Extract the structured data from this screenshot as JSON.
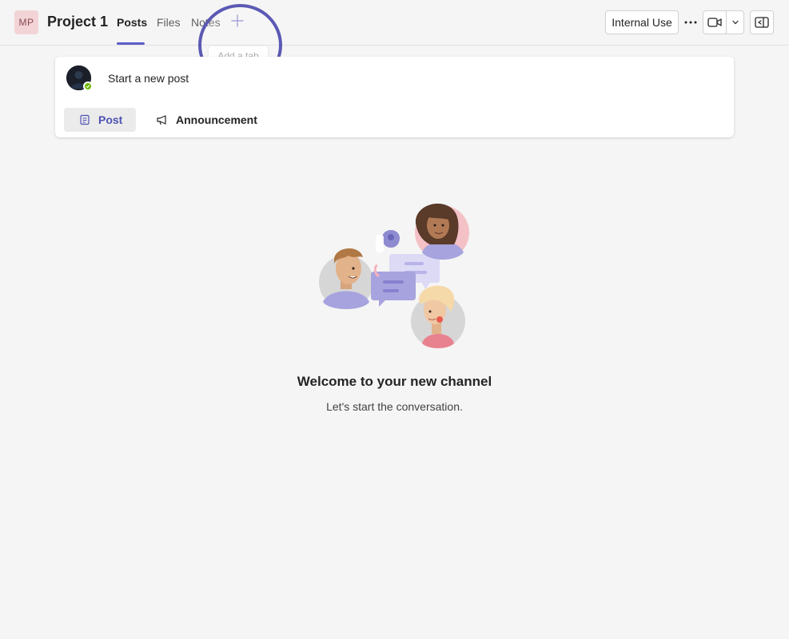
{
  "header": {
    "team_initials": "MP",
    "team_name": "Project 1",
    "tabs": [
      {
        "label": "Posts",
        "active": true
      },
      {
        "label": "Files",
        "active": false
      },
      {
        "label": "Notes",
        "active": false
      }
    ],
    "add_tab_tooltip": "Add a tab",
    "sensitivity_label": "Internal Use",
    "icons": {
      "add_tab": "plus-icon",
      "more": "more-horizontal-icon",
      "video": "video-camera-icon",
      "dropdown": "chevron-down-icon",
      "panel": "panel-toggle-icon"
    }
  },
  "compose": {
    "prompt": "Start a new post",
    "post_label": "Post",
    "announcement_label": "Announcement",
    "presence_status": "available"
  },
  "empty_state": {
    "title": "Welcome to your new channel",
    "subtitle": "Let's start the conversation."
  },
  "colors": {
    "accent": "#5b5fc7",
    "highlight_ring": "#5b59b4",
    "team_avatar_bg": "#f2d4d6",
    "presence_available": "#6bb700"
  }
}
